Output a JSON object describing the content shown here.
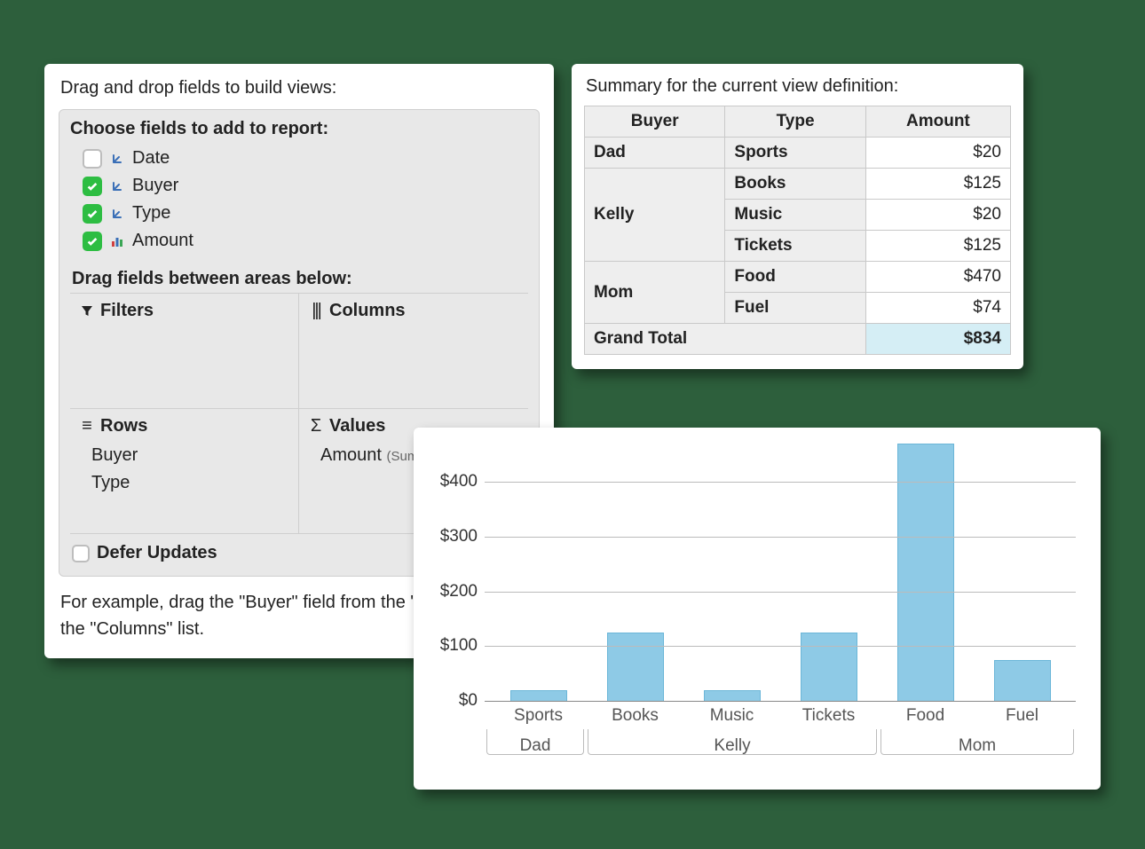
{
  "builder": {
    "intro": "Drag and drop fields to build views:",
    "choose_label": "Choose fields to add to report:",
    "fields": [
      {
        "label": "Date",
        "checked": false,
        "icon": "dim"
      },
      {
        "label": "Buyer",
        "checked": true,
        "icon": "dim"
      },
      {
        "label": "Type",
        "checked": true,
        "icon": "dim"
      },
      {
        "label": "Amount",
        "checked": true,
        "icon": "measure"
      }
    ],
    "drag_label": "Drag fields between areas below:",
    "areas": {
      "filters": {
        "label": "Filters",
        "items": []
      },
      "columns": {
        "label": "Columns",
        "items": []
      },
      "rows": {
        "label": "Rows",
        "items": [
          "Buyer",
          "Type"
        ]
      },
      "values": {
        "label": "Values",
        "items": [
          {
            "field": "Amount",
            "agg": "(Sum)"
          }
        ]
      }
    },
    "defer_label": "Defer Updates",
    "example_line1": "For example, drag the \"Buyer\" field from the \"Rows\" list to",
    "example_line2": "the \"Columns\" list."
  },
  "summary": {
    "intro": "Summary for the current view definition:",
    "columns": [
      "Buyer",
      "Type",
      "Amount"
    ],
    "rows": [
      {
        "buyer": "Dad",
        "type": "Sports",
        "amount": "$20"
      },
      {
        "buyer": "Kelly",
        "type": "Books",
        "amount": "$125"
      },
      {
        "buyer": "Kelly",
        "type": "Music",
        "amount": "$20"
      },
      {
        "buyer": "Kelly",
        "type": "Tickets",
        "amount": "$125"
      },
      {
        "buyer": "Mom",
        "type": "Food",
        "amount": "$470"
      },
      {
        "buyer": "Mom",
        "type": "Fuel",
        "amount": "$74"
      }
    ],
    "grand_total": {
      "label": "Grand Total",
      "amount": "$834"
    }
  },
  "chart_data": {
    "type": "bar",
    "ylabel": "",
    "xlabel": "",
    "y_ticks": [
      "$0",
      "$100",
      "$200",
      "$300",
      "$400"
    ],
    "ylim": [
      0,
      470
    ],
    "categories": [
      "Sports",
      "Books",
      "Music",
      "Tickets",
      "Food",
      "Fuel"
    ],
    "values": [
      20,
      125,
      20,
      125,
      470,
      74
    ],
    "groups": [
      {
        "label": "Dad",
        "span": 1
      },
      {
        "label": "Kelly",
        "span": 3
      },
      {
        "label": "Mom",
        "span": 2
      }
    ]
  }
}
